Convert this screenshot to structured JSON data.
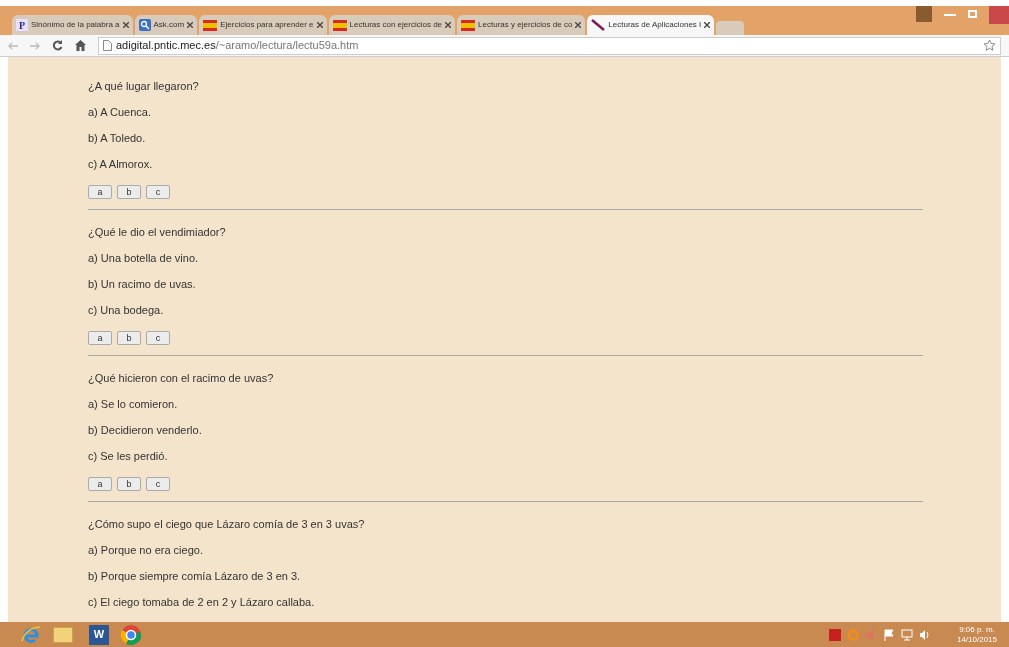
{
  "tabs": [
    {
      "title": "Sinónimo de la palabra a",
      "logo": "P",
      "selected": false
    },
    {
      "title": "Ask.com",
      "selected": false
    },
    {
      "title": "Ejercicios para aprender e",
      "selected": false
    },
    {
      "title": "Lecturas con ejercicios de",
      "selected": false
    },
    {
      "title": "Lecturas y ejercicios de co",
      "selected": false
    },
    {
      "title": "Lecturas de Aplicaciones I",
      "selected": true
    }
  ],
  "address": {
    "domain": "adigital.pntic.mec.es",
    "path": "/~aramo/lectura/lectu59a.htm"
  },
  "questions": [
    {
      "question": "¿A qué lugar llegaron?",
      "options": [
        "a) A Cuenca.",
        "b) A Toledo.",
        "c) A Almorox."
      ],
      "buttons": [
        "a",
        "b",
        "c"
      ]
    },
    {
      "question": "¿Qué le dio el vendimiador?",
      "options": [
        "a) Una botella de vino.",
        "b) Un racimo de uvas.",
        "c) Una bodega."
      ],
      "buttons": [
        "a",
        "b",
        "c"
      ]
    },
    {
      "question": "¿Qué hicieron con el racimo de uvas?",
      "options": [
        "a) Se lo comieron.",
        "b) Decidieron venderlo.",
        "c) Se les perdió."
      ],
      "buttons": [
        "a",
        "b",
        "c"
      ]
    },
    {
      "question": "¿Cómo supo el ciego que Lázaro comía de 3 en 3 uvas?",
      "options": [
        "a) Porque no era ciego.",
        "b) Porque siempre comía Lázaro de 3 en 3.",
        "c) El ciego tomaba de 2 en 2 y Lázaro callaba."
      ]
    }
  ],
  "taskbar": {
    "word_app_letter": "W",
    "time": "9:06 p. m.",
    "date": "14/10/2015"
  }
}
